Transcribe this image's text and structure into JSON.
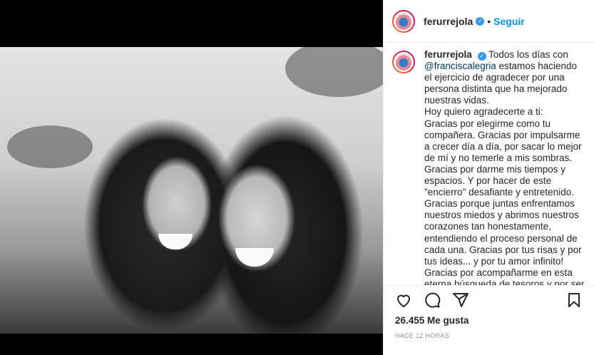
{
  "post": {
    "username": "ferurrejola",
    "follow_label": "Seguir",
    "dot": "•",
    "caption": {
      "username": "ferurrejola",
      "intro": " Todos los días con ",
      "mention": "@franciscalegria",
      "after_mention": " estamos haciendo el ejercicio de agradecer por una persona distinta que ha mejorado nuestras vidas.",
      "paragraphs": [
        "Hoy quiero agradecerte a ti:",
        "Gracias por elegirme como tu compañera. Gracias por impulsarme a crecer día a día, por sacar lo mejor de mí y no temerle a mis sombras.",
        "Gracias por darme mis tiempos y espacios. Y por hacer de este \"encierro\" desafiante y entretenido.",
        "Gracias porque juntas enfrentamos nuestros miedos y abrimos nuestros corazones tan honestamente, entendiendo el proceso personal de cada una. Gracias por tus risas y por tus ideas... y por tu amor infinito!",
        "Gracias por acompañarme en esta eterna búsqueda de tesoros y por ser"
      ]
    },
    "likes": "26.455 Me gusta",
    "time": "HACE 12 HORAS"
  },
  "icons": {
    "like": "heart-icon",
    "comment": "comment-icon",
    "share": "share-icon",
    "save": "bookmark-icon",
    "verified": "verified-badge-icon"
  },
  "colors": {
    "accent": "#0095f6",
    "verified": "#3897f0",
    "muted": "#8e8e8e"
  }
}
